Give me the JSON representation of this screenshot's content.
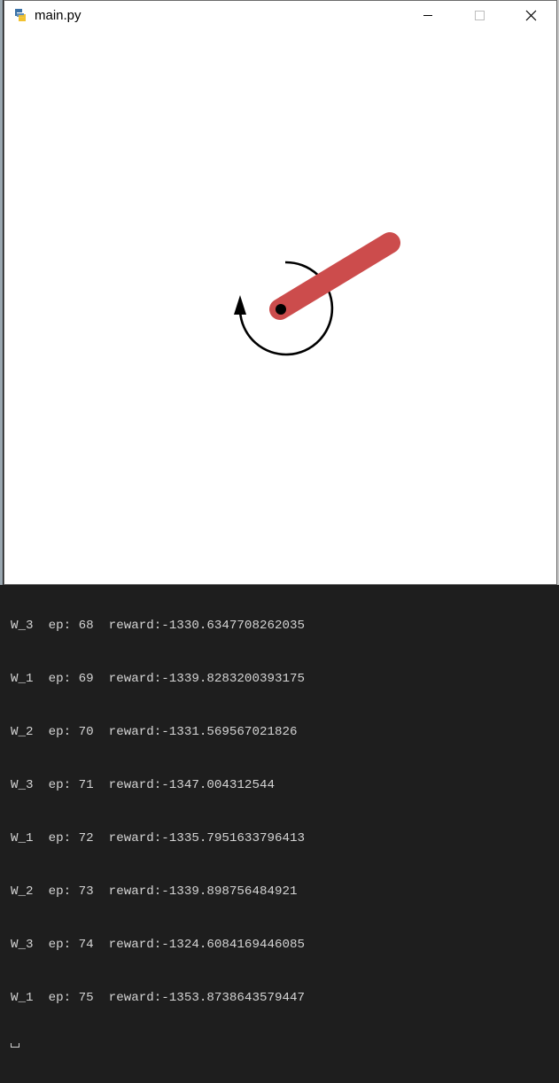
{
  "window": {
    "title": "main.py",
    "icon": "python-icon",
    "controls": [
      "minimize-icon",
      "maximize-icon",
      "close-icon"
    ]
  },
  "scene": {
    "rod_color": "#cc4c4c",
    "pivot_color": "#000000",
    "arrow_color": "#000000"
  },
  "console": {
    "lines": [
      "W_3  ep: 68  reward:-1330.6347708262035",
      "W_1  ep: 69  reward:-1339.8283200393175",
      "W_2  ep: 70  reward:-1331.569567021826",
      "W_3  ep: 71  reward:-1347.004312544",
      "W_1  ep: 72  reward:-1335.7951633796413",
      "W_2  ep: 73  reward:-1339.898756484921",
      "W_3  ep: 74  reward:-1324.6084169446085",
      "W_1  ep: 75  reward:-1353.8738643579447"
    ]
  }
}
